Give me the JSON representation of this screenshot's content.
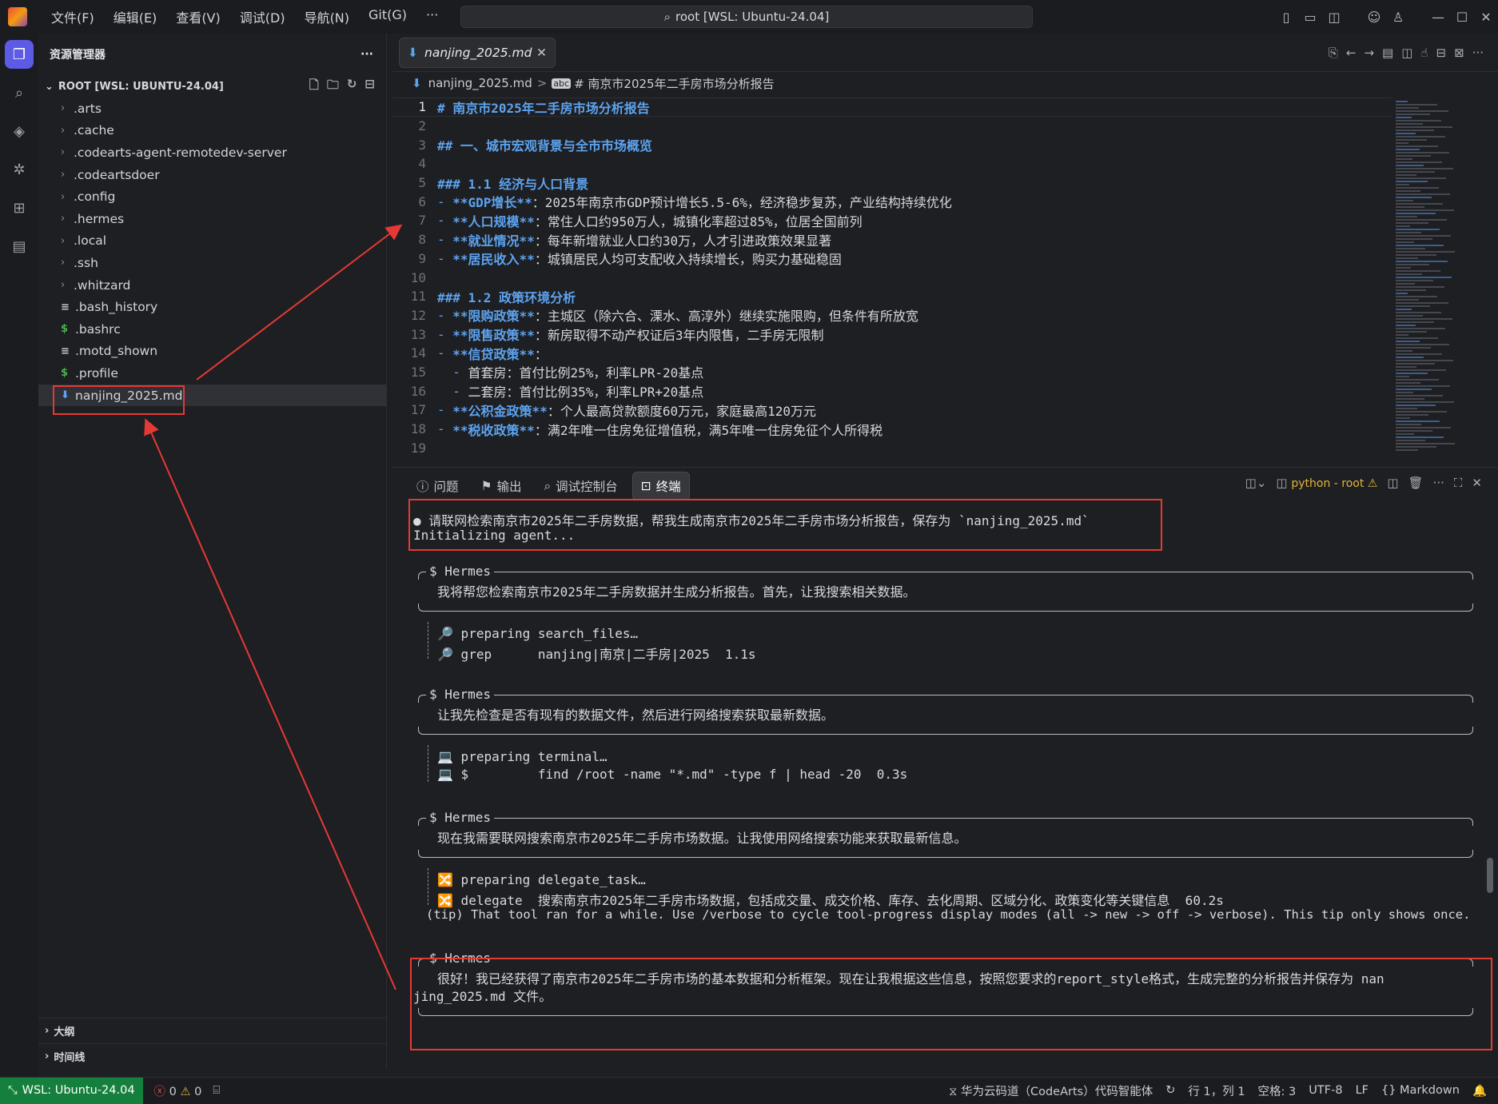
{
  "titlebar": {
    "menu": [
      "文件(F)",
      "编辑(E)",
      "查看(V)",
      "调试(D)",
      "导航(N)",
      "Git(G)",
      "···"
    ],
    "command_center": "root [WSL: Ubuntu-24.04]"
  },
  "sidebar": {
    "title": "资源管理器",
    "more": "···",
    "root_label": "ROOT [WSL: UBUNTU-24.04]",
    "items": [
      {
        "label": ".arts",
        "kind": "folder"
      },
      {
        "label": ".cache",
        "kind": "folder"
      },
      {
        "label": ".codearts-agent-remotedev-server",
        "kind": "folder"
      },
      {
        "label": ".codeartsdoer",
        "kind": "folder"
      },
      {
        "label": ".config",
        "kind": "folder"
      },
      {
        "label": ".hermes",
        "kind": "folder"
      },
      {
        "label": ".local",
        "kind": "folder"
      },
      {
        "label": ".ssh",
        "kind": "folder"
      },
      {
        "label": ".whitzard",
        "kind": "folder"
      },
      {
        "label": ".bash_history",
        "kind": "file-text"
      },
      {
        "label": ".bashrc",
        "kind": "file-shell"
      },
      {
        "label": ".motd_shown",
        "kind": "file-text"
      },
      {
        "label": ".profile",
        "kind": "file-shell"
      },
      {
        "label": "nanjing_2025.md",
        "kind": "file-md",
        "selected": true
      }
    ],
    "outline": "大纲",
    "timeline": "时间线"
  },
  "editor": {
    "tab_label": "nanjing_2025.md",
    "close": "✕",
    "breadcrumb_file": "nanjing_2025.md",
    "breadcrumb_sep": ">",
    "breadcrumb_heading": "# 南京市2025年二手房市场分析报告",
    "lines": [
      {
        "n": "1",
        "parts": [
          {
            "c": "h",
            "t": "# 南京市2025年二手房市场分析报告"
          }
        ]
      },
      {
        "n": "2",
        "parts": []
      },
      {
        "n": "3",
        "parts": [
          {
            "c": "h",
            "t": "## 一、城市宏观背景与全市市场概览"
          }
        ]
      },
      {
        "n": "4",
        "parts": []
      },
      {
        "n": "5",
        "parts": [
          {
            "c": "h",
            "t": "### 1.1 经济与人口背景"
          }
        ]
      },
      {
        "n": "6",
        "parts": [
          {
            "c": "d",
            "t": "- "
          },
          {
            "c": "b",
            "t": "**GDP增长**"
          },
          {
            "c": "t",
            "t": "：2025年南京市GDP预计增长5.5-6%，经济稳步复苏，产业结构持续优化"
          }
        ]
      },
      {
        "n": "7",
        "parts": [
          {
            "c": "d",
            "t": "- "
          },
          {
            "c": "b",
            "t": "**人口规模**"
          },
          {
            "c": "t",
            "t": "：常住人口约950万人，城镇化率超过85%，位居全国前列"
          }
        ]
      },
      {
        "n": "8",
        "parts": [
          {
            "c": "d",
            "t": "- "
          },
          {
            "c": "b",
            "t": "**就业情况**"
          },
          {
            "c": "t",
            "t": "：每年新增就业人口约30万，人才引进政策效果显著"
          }
        ]
      },
      {
        "n": "9",
        "parts": [
          {
            "c": "d",
            "t": "- "
          },
          {
            "c": "b",
            "t": "**居民收入**"
          },
          {
            "c": "t",
            "t": "：城镇居民人均可支配收入持续增长，购买力基础稳固"
          }
        ]
      },
      {
        "n": "10",
        "parts": []
      },
      {
        "n": "11",
        "parts": [
          {
            "c": "h",
            "t": "### 1.2 政策环境分析"
          }
        ]
      },
      {
        "n": "12",
        "parts": [
          {
            "c": "d",
            "t": "- "
          },
          {
            "c": "b",
            "t": "**限购政策**"
          },
          {
            "c": "t",
            "t": "：主城区（除六合、溧水、高淳外）继续实施限购，但条件有所放宽"
          }
        ]
      },
      {
        "n": "13",
        "parts": [
          {
            "c": "d",
            "t": "- "
          },
          {
            "c": "b",
            "t": "**限售政策**"
          },
          {
            "c": "t",
            "t": "：新房取得不动产权证后3年内限售，二手房无限制"
          }
        ]
      },
      {
        "n": "14",
        "parts": [
          {
            "c": "d",
            "t": "- "
          },
          {
            "c": "b",
            "t": "**信贷政策**"
          },
          {
            "c": "t",
            "t": "："
          }
        ]
      },
      {
        "n": "15",
        "parts": [
          {
            "c": "d",
            "t": "  - "
          },
          {
            "c": "t",
            "t": "首套房：首付比例25%，利率LPR-20基点"
          }
        ]
      },
      {
        "n": "16",
        "parts": [
          {
            "c": "d",
            "t": "  - "
          },
          {
            "c": "t",
            "t": "二套房：首付比例35%，利率LPR+20基点"
          }
        ]
      },
      {
        "n": "17",
        "parts": [
          {
            "c": "d",
            "t": "- "
          },
          {
            "c": "b",
            "t": "**公积金政策**"
          },
          {
            "c": "t",
            "t": "：个人最高贷款额度60万元，家庭最高120万元"
          }
        ]
      },
      {
        "n": "18",
        "parts": [
          {
            "c": "d",
            "t": "- "
          },
          {
            "c": "b",
            "t": "**税收政策**"
          },
          {
            "c": "t",
            "t": "：满2年唯一住房免征增值税，满5年唯一住房免征个人所得税"
          }
        ]
      },
      {
        "n": "19",
        "parts": []
      }
    ]
  },
  "panel": {
    "tabs": [
      "问题",
      "输出",
      "调试控制台",
      "终端"
    ],
    "terminal_name": "python - root",
    "terminal": {
      "prompt": "● 请联网检索南京市2025年二手房数据，帮我生成南京市2025年二手房市场分析报告，保存为 `nanjing_2025.md`",
      "init": "Initializing agent...",
      "hermes_label": "$ Hermes",
      "msg1": "我将帮您检索南京市2025年二手房数据并生成分析报告。首先，让我搜索相关数据。",
      "tool1a": "🔎 preparing search_files…",
      "tool1b": "🔎 grep      nanjing|南京|二手房|2025  1.1s",
      "msg2": "让我先检查是否有现有的数据文件，然后进行网络搜索获取最新数据。",
      "tool2a": "💻 preparing terminal…",
      "tool2b": "💻 $         find /root -name \"*.md\" -type f | head -20  0.3s",
      "msg3": "现在我需要联网搜索南京市2025年二手房市场数据。让我使用网络搜索功能来获取最新信息。",
      "tool3a": "🔀 preparing delegate_task…",
      "tool3b": "🔀 delegate  搜索南京市2025年二手房市场数据，包括成交量、成交价格、库存、去化周期、区域分化、政策变化等关键信息  60.2s",
      "tip": "(tip) That tool ran for a while. Use /verbose to cycle tool-progress display modes (all -> new -> off -> verbose). This tip only shows once.",
      "msg4a": "很好！我已经获得了南京市2025年二手房市场的基本数据和分析框架。现在让我根据这些信息，按照您要求的report_style格式，生成完整的分析报告并保存为 nan",
      "msg4b": "jing_2025.md 文件。"
    }
  },
  "status": {
    "remote": "WSL: Ubuntu-24.04",
    "errors": "0",
    "warnings": "0",
    "assistant": "华为云码道（CodeArts）代码智能体",
    "position": "行 1，列 1",
    "spaces": "空格: 3",
    "encoding": "UTF-8",
    "eol": "LF",
    "language": "Markdown"
  },
  "colors": {
    "accent": "#5b5be6",
    "remote": "#15803d",
    "heading": "#5da3f0",
    "annotation": "#e53935"
  }
}
